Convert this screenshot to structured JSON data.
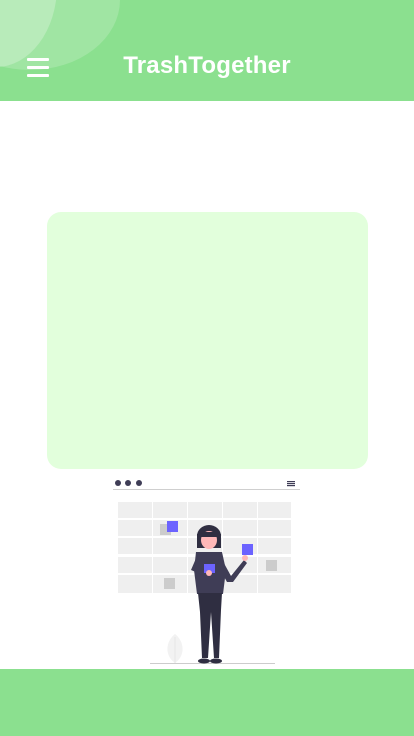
{
  "header": {
    "app_title": "TrashTogether",
    "menu_icon": "hamburger-menu-icon"
  },
  "colors": {
    "brand_green": "#8be08f",
    "card_background": "#e2ffdc",
    "accent_purple": "#6c63ff",
    "figure_dark": "#2f2e41"
  },
  "main": {
    "illustration_icon": "calendar-planning-illustration"
  }
}
